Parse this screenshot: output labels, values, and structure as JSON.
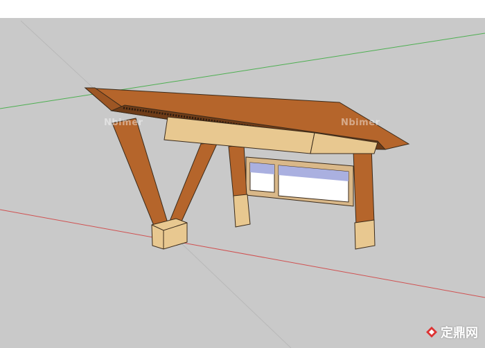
{
  "scene": {
    "subject": "timber-bus-shelter-sketchup-model",
    "colors": {
      "sky_band": "#ffffff",
      "ground": "#c9c9c9",
      "red_axis": "#d05050",
      "green_axis": "#4caf50",
      "dark_wood": "#b5652b",
      "light_wood": "#e8c890",
      "panel_frame": "#d9b889"
    }
  },
  "watermarks": {
    "left": "Nbimer",
    "right": "Nbimer"
  },
  "brand": {
    "text": "定鼎网",
    "icon": "diamond-logo-icon"
  }
}
